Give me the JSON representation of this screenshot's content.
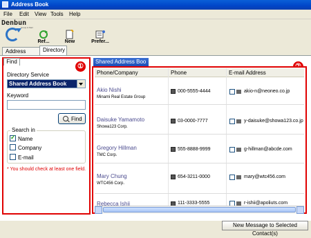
{
  "window": {
    "title": "Address Book"
  },
  "menu": [
    "File",
    "Edit",
    "View",
    "Tools",
    "Help"
  ],
  "logo": {
    "text": "Denbun",
    "sub": "Group & Mail"
  },
  "toolbar": {
    "refresh_label": "Ref...",
    "new_label": "New",
    "preferences_label": "Prefer..."
  },
  "tabs": {
    "address_book": "Address Book",
    "directory": "Directory"
  },
  "left": {
    "find_tab": "Find",
    "directory_service_label": "Directory Service",
    "directory_service_value": "Shared Address Book",
    "keyword_label": "Keyword",
    "keyword_value": "",
    "find_button": "Find",
    "search_in_label": "Search in",
    "options": [
      {
        "label": "Name",
        "checked": true
      },
      {
        "label": "Company",
        "checked": false
      },
      {
        "label": "E-mail",
        "checked": false
      }
    ],
    "hint": "* You should check at least one field."
  },
  "annotations": {
    "left_marker": "①",
    "right_marker": "②"
  },
  "right": {
    "tab": "Shared Address Boo",
    "columns": [
      "Phone/Company",
      "Phone",
      "E-mail Address"
    ],
    "rows": [
      {
        "name": "Akio Nishi",
        "company": "Minami Real Estate Group",
        "phone": "000-5555-4444",
        "email": "akio-n@neoneo.co.jp"
      },
      {
        "name": "Daisuke Yamamoto",
        "company": "Showa123 Corp.",
        "phone": "03-0000-7777",
        "email": "y-daisuke@showa123.co.jp"
      },
      {
        "name": "Gregory Hillman",
        "company": "TMC Corp.",
        "phone": "555-8888-9999",
        "email": "g-hillman@abcde.com"
      },
      {
        "name": "Mary Chung",
        "company": "WTC456 Corp.",
        "phone": "654-3211-0000",
        "email": "mary@wtc456.com"
      },
      {
        "name": "Rebecca Ishii",
        "company": "",
        "phone": "111-3333-5555",
        "email": "r-ishii@apoliuts.com"
      }
    ]
  },
  "bottom": {
    "new_message_button": "New Message to Selected Contact(s)"
  },
  "colors": {
    "highlight_red": "#e00000",
    "title_blue": "#0046c8",
    "name_purple": "#4a4a8e"
  }
}
